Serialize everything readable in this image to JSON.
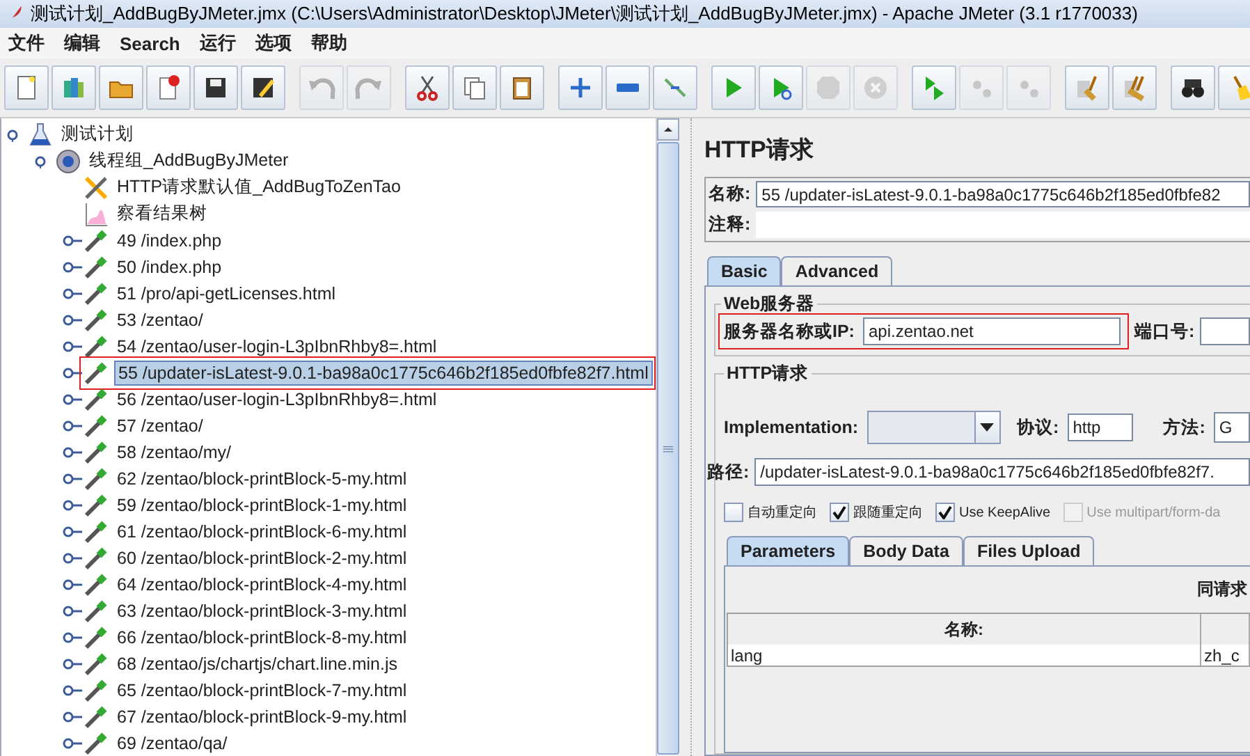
{
  "window": {
    "title": "测试计划_AddBugByJMeter.jmx (C:\\Users\\Administrator\\Desktop\\JMeter\\测试计划_AddBugByJMeter.jmx) - Apache JMeter (3.1 r1770033)"
  },
  "menu": [
    "文件",
    "编辑",
    "Search",
    "运行",
    "选项",
    "帮助"
  ],
  "toolbar": [
    [
      {
        "kind": "new",
        "disabled": false
      },
      {
        "kind": "templates",
        "disabled": false
      },
      {
        "kind": "open",
        "disabled": false
      },
      {
        "kind": "close",
        "disabled": false
      },
      {
        "kind": "save",
        "disabled": false
      },
      {
        "kind": "save-as",
        "disabled": false
      }
    ],
    [
      {
        "kind": "undo",
        "disabled": true
      },
      {
        "kind": "redo",
        "disabled": true
      }
    ],
    [
      {
        "kind": "cut",
        "disabled": false
      },
      {
        "kind": "copy",
        "disabled": false
      },
      {
        "kind": "paste",
        "disabled": false
      }
    ],
    [
      {
        "kind": "expand",
        "disabled": false
      },
      {
        "kind": "collapse",
        "disabled": false
      },
      {
        "kind": "toggle",
        "disabled": false
      }
    ],
    [
      {
        "kind": "start",
        "disabled": false
      },
      {
        "kind": "start-no-timers",
        "disabled": false
      },
      {
        "kind": "stop",
        "disabled": true
      },
      {
        "kind": "shutdown",
        "disabled": true
      }
    ],
    [
      {
        "kind": "remote-start",
        "disabled": false
      },
      {
        "kind": "remote-stop",
        "disabled": true
      },
      {
        "kind": "remote-shutdown",
        "disabled": true
      }
    ],
    [
      {
        "kind": "clear",
        "disabled": false
      },
      {
        "kind": "clear-all",
        "disabled": false
      }
    ],
    [
      {
        "kind": "search",
        "disabled": false
      },
      {
        "kind": "reset",
        "disabled": false
      }
    ]
  ],
  "tree": [
    {
      "label": "测试计划",
      "kind": "plan",
      "expanded": true,
      "selected": false,
      "outlined": false,
      "children": [
        {
          "label": "线程组_AddBugByJMeter",
          "kind": "thread-group",
          "expanded": true,
          "selected": false,
          "outlined": false,
          "children": [
            {
              "label": "HTTP请求默认值_AddBugToZenTao",
              "kind": "config",
              "selected": false,
              "outlined": false
            },
            {
              "label": "察看结果树",
              "kind": "listener",
              "selected": false,
              "outlined": false
            },
            {
              "label": "49 /index.php",
              "kind": "sampler",
              "expanded": false,
              "selected": false,
              "outlined": false
            },
            {
              "label": "50 /index.php",
              "kind": "sampler",
              "expanded": false,
              "selected": false,
              "outlined": false
            },
            {
              "label": "51 /pro/api-getLicenses.html",
              "kind": "sampler",
              "expanded": false,
              "selected": false,
              "outlined": false
            },
            {
              "label": "53 /zentao/",
              "kind": "sampler",
              "expanded": false,
              "selected": false,
              "outlined": false
            },
            {
              "label": "54 /zentao/user-login-L3pIbnRhby8=.html",
              "kind": "sampler",
              "expanded": false,
              "selected": false,
              "outlined": false
            },
            {
              "label": "55 /updater-isLatest-9.0.1-ba98a0c1775c646b2f185ed0fbfe82f7.html",
              "kind": "sampler",
              "expanded": false,
              "selected": true,
              "outlined": true
            },
            {
              "label": "56 /zentao/user-login-L3pIbnRhby8=.html",
              "kind": "sampler",
              "expanded": false,
              "selected": false,
              "outlined": false
            },
            {
              "label": "57 /zentao/",
              "kind": "sampler",
              "expanded": false,
              "selected": false,
              "outlined": false
            },
            {
              "label": "58 /zentao/my/",
              "kind": "sampler",
              "expanded": false,
              "selected": false,
              "outlined": false
            },
            {
              "label": "62 /zentao/block-printBlock-5-my.html",
              "kind": "sampler",
              "expanded": false,
              "selected": false,
              "outlined": false
            },
            {
              "label": "59 /zentao/block-printBlock-1-my.html",
              "kind": "sampler",
              "expanded": false,
              "selected": false,
              "outlined": false
            },
            {
              "label": "61 /zentao/block-printBlock-6-my.html",
              "kind": "sampler",
              "expanded": false,
              "selected": false,
              "outlined": false
            },
            {
              "label": "60 /zentao/block-printBlock-2-my.html",
              "kind": "sampler",
              "expanded": false,
              "selected": false,
              "outlined": false
            },
            {
              "label": "64 /zentao/block-printBlock-4-my.html",
              "kind": "sampler",
              "expanded": false,
              "selected": false,
              "outlined": false
            },
            {
              "label": "63 /zentao/block-printBlock-3-my.html",
              "kind": "sampler",
              "expanded": false,
              "selected": false,
              "outlined": false
            },
            {
              "label": "66 /zentao/block-printBlock-8-my.html",
              "kind": "sampler",
              "expanded": false,
              "selected": false,
              "outlined": false
            },
            {
              "label": "68 /zentao/js/chartjs/chart.line.min.js",
              "kind": "sampler",
              "expanded": false,
              "selected": false,
              "outlined": false
            },
            {
              "label": "65 /zentao/block-printBlock-7-my.html",
              "kind": "sampler",
              "expanded": false,
              "selected": false,
              "outlined": false
            },
            {
              "label": "67 /zentao/block-printBlock-9-my.html",
              "kind": "sampler",
              "expanded": false,
              "selected": false,
              "outlined": false
            },
            {
              "label": "69 /zentao/qa/",
              "kind": "sampler",
              "expanded": false,
              "selected": false,
              "outlined": false
            }
          ]
        }
      ]
    }
  ],
  "panel": {
    "title": "HTTP请求",
    "name": {
      "label": "名称:",
      "value": "55 /updater-isLatest-9.0.1-ba98a0c1775c646b2f185ed0fbfe82"
    },
    "comment": {
      "label": "注释:"
    },
    "tabs": [
      {
        "label": "Basic",
        "selected": true
      },
      {
        "label": "Advanced",
        "selected": false
      }
    ],
    "web_server": {
      "title": "Web服务器",
      "server": {
        "label": "服务器名称或IP:",
        "value": "api.zentao.net",
        "outlined": true
      },
      "port": {
        "label": "端口号:"
      }
    },
    "http_request": {
      "title": "HTTP请求",
      "implementation": {
        "label": "Implementation:"
      },
      "protocol": {
        "label": "协议:",
        "value": "http"
      },
      "method": {
        "label": "方法:",
        "value": "G"
      },
      "path": {
        "label": "路径:",
        "value": "/updater-isLatest-9.0.1-ba98a0c1775c646b2f185ed0fbfe82f7."
      },
      "options": [
        {
          "label": "自动重定向",
          "checked": false,
          "disabled": false
        },
        {
          "label": "跟随重定向",
          "checked": true,
          "disabled": false
        },
        {
          "label": "Use KeepAlive",
          "checked": true,
          "disabled": false
        },
        {
          "label": "Use multipart/form-da",
          "checked": false,
          "disabled": true
        }
      ],
      "subtabs": [
        {
          "label": "Parameters",
          "selected": true
        },
        {
          "label": "Body Data",
          "selected": false
        },
        {
          "label": "Files Upload",
          "selected": false
        }
      ],
      "table": {
        "caption": "同请求",
        "columns": [
          "名称:"
        ],
        "rows": [
          {
            "cells": [
              "lang",
              "zh_c"
            ]
          }
        ]
      }
    }
  }
}
